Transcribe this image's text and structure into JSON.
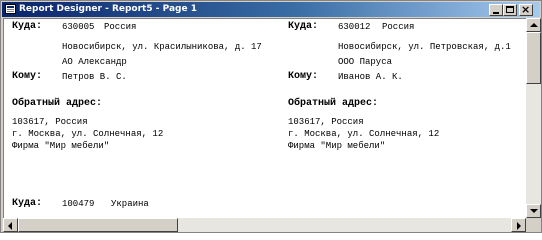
{
  "window": {
    "title": "Report Designer - Report5 - Page 1",
    "close_glyph": "×"
  },
  "report": {
    "left": {
      "to_label": "Куда:",
      "to_index": "630005",
      "to_country": "Россия",
      "to_address": "Новосибирск, ул. Красилыникова, д. 17",
      "to_company": "АО Александр",
      "whom_label": "Кому:",
      "whom_name": "Петров В. С.",
      "return_label": "Обратный адрес:",
      "return_line1": "103617, Россия",
      "return_line2": "г. Москва, ул. Солнечная, 12",
      "return_line3": "Фирма \"Мир мебели\""
    },
    "right": {
      "to_label": "Куда:",
      "to_index": "630012",
      "to_country": "Россия",
      "to_address": "Новосибирск, ул. Петровская, д.1",
      "to_company": "ООО Паруса",
      "whom_label": "Кому:",
      "whom_name": "Иванов А. К.",
      "return_label": "Обратный адрес:",
      "return_line1": "103617, Россия",
      "return_line2": "г. Москва, ул. Солнечная, 12",
      "return_line3": "Фирма \"Мир мебели\""
    },
    "bottom": {
      "to_label": "Куда:",
      "to_index": "100479",
      "to_country": "Украина"
    }
  },
  "scrollbars": {
    "vertical_position": 0.0,
    "horizontal_position": 0.0
  },
  "icons": {
    "app": "report-icon",
    "minimize": "minimize-icon",
    "maximize": "maximize-icon",
    "close": "close-icon"
  }
}
